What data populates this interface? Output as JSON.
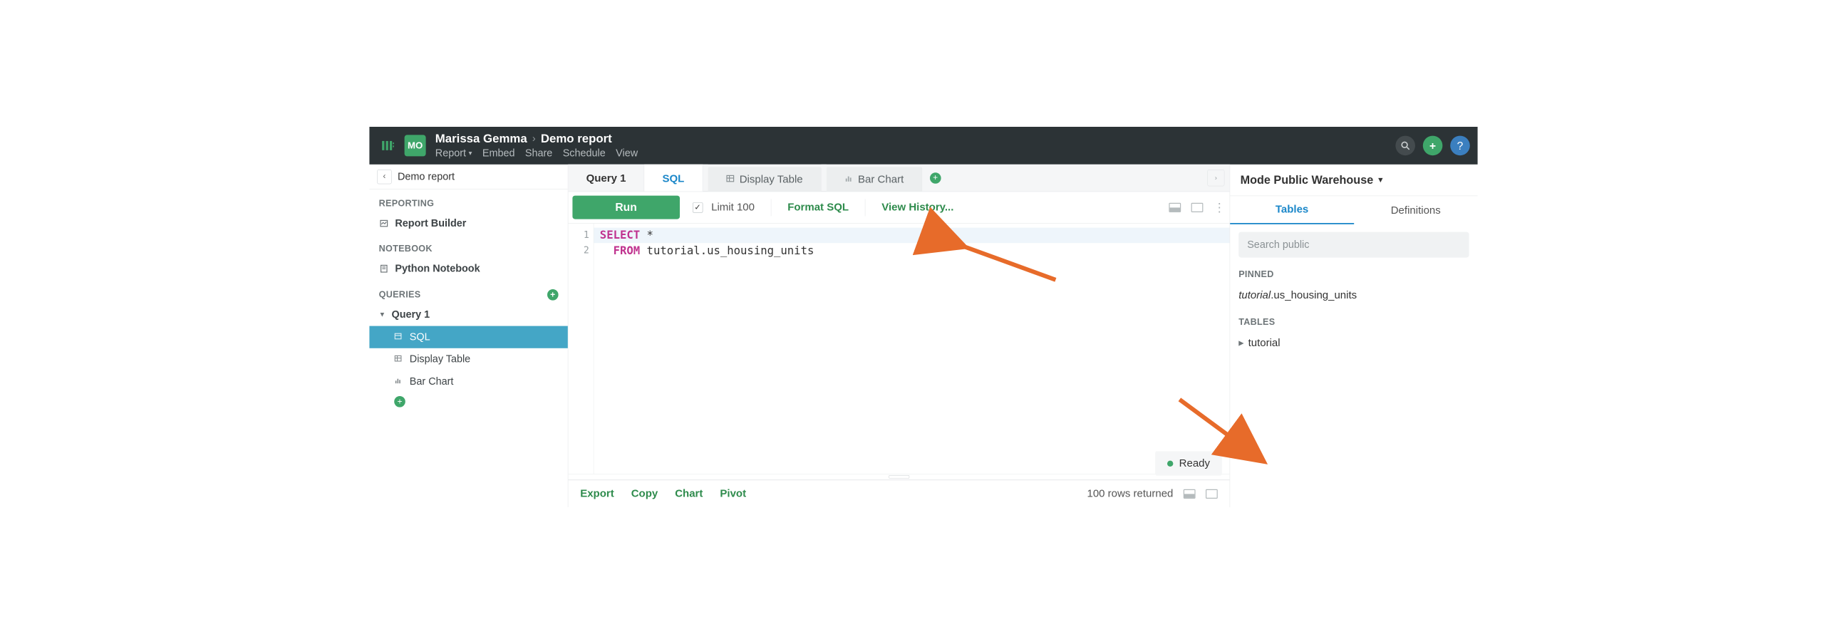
{
  "header": {
    "badge": "MO",
    "user": "Marissa Gemma",
    "report_name": "Demo report",
    "menu": {
      "report": "Report",
      "embed": "Embed",
      "share": "Share",
      "schedule": "Schedule",
      "view": "View"
    }
  },
  "left": {
    "breadcrumb": "Demo report",
    "sections": {
      "reporting": "REPORTING",
      "notebook": "NOTEBOOK",
      "queries": "QUERIES"
    },
    "report_builder": "Report Builder",
    "python_notebook": "Python Notebook",
    "query1": "Query 1",
    "sql": "SQL",
    "display_table": "Display Table",
    "bar_chart": "Bar Chart"
  },
  "tabs": {
    "query1": "Query 1",
    "sql": "SQL",
    "display_table": "Display Table",
    "bar_chart": "Bar Chart"
  },
  "toolbar": {
    "run": "Run",
    "limit": "Limit 100",
    "format_sql": "Format SQL",
    "view_history": "View History..."
  },
  "editor": {
    "line_numbers": [
      "1",
      "2"
    ],
    "line1_kw": "SELECT",
    "line1_rest": " *",
    "line2_kw": "FROM",
    "line2_rest": " tutorial.us_housing_units"
  },
  "status": {
    "ready": "Ready"
  },
  "bottom": {
    "export": "Export",
    "copy": "Copy",
    "chart": "Chart",
    "pivot": "Pivot",
    "rows_returned": "100 rows returned"
  },
  "right": {
    "datasource": "Mode Public Warehouse",
    "tabs": {
      "tables": "Tables",
      "definitions": "Definitions"
    },
    "search_placeholder": "Search public",
    "pinned_label": "PINNED",
    "pinned_item_schema": "tutorial",
    "pinned_item_table": ".us_housing_units",
    "tables_label": "TABLES",
    "tables_item": "tutorial"
  }
}
